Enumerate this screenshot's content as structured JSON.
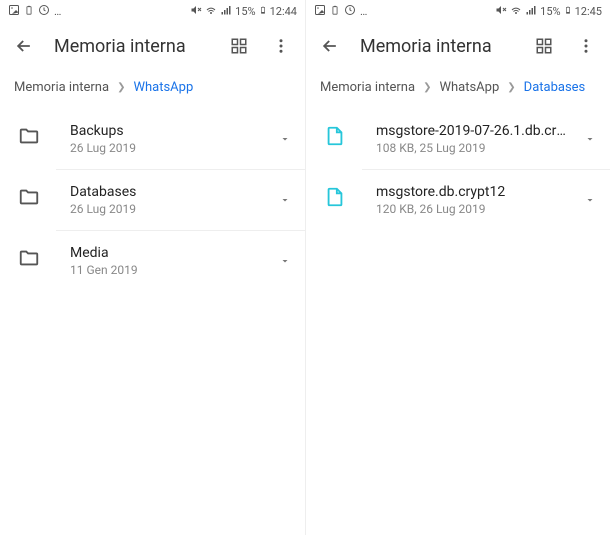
{
  "panels": [
    {
      "status": {
        "time": "12:44",
        "battery": "15%"
      },
      "title": "Memoria interna",
      "breadcrumbs": [
        {
          "label": "Memoria interna",
          "active": false
        },
        {
          "label": "WhatsApp",
          "active": true
        }
      ],
      "rows": [
        {
          "type": "folder",
          "name": "Backups",
          "sub": "26 Lug 2019"
        },
        {
          "type": "folder",
          "name": "Databases",
          "sub": "26 Lug 2019"
        },
        {
          "type": "folder",
          "name": "Media",
          "sub": "11 Gen 2019"
        }
      ]
    },
    {
      "status": {
        "time": "12:45",
        "battery": "15%"
      },
      "title": "Memoria interna",
      "breadcrumbs": [
        {
          "label": "Memoria interna",
          "active": false
        },
        {
          "label": "WhatsApp",
          "active": false
        },
        {
          "label": "Databases",
          "active": true
        }
      ],
      "rows": [
        {
          "type": "file",
          "name": "msgstore-2019-07-26.1.db.cry…",
          "sub": "108 KB, 25 Lug 2019"
        },
        {
          "type": "file",
          "name": "msgstore.db.crypt12",
          "sub": "120 KB, 26 Lug 2019"
        }
      ]
    }
  ]
}
